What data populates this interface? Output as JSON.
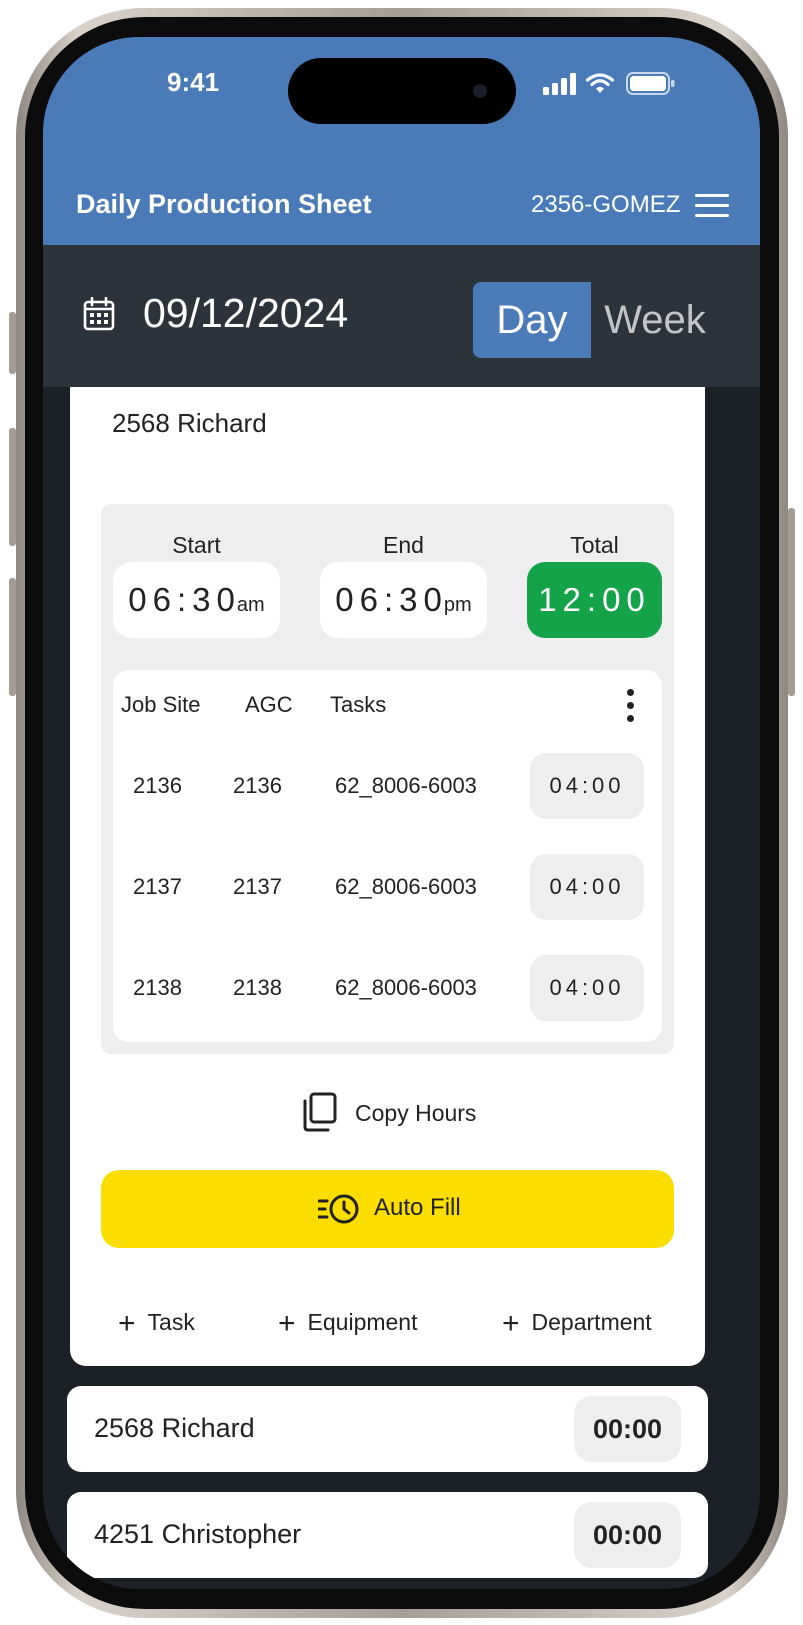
{
  "status_bar": {
    "time": "9:41",
    "icons": [
      "signal-icon",
      "wifi-icon",
      "battery-icon"
    ]
  },
  "header": {
    "title": "Daily Production Sheet",
    "user_code": "2356-GOMEZ",
    "menu_icon": "hamburger-menu-icon"
  },
  "date_bar": {
    "date": "09/12/2024",
    "calendar_icon": "calendar-icon",
    "view_toggle": {
      "day_label": "Day",
      "week_label": "Week",
      "selected": "Day"
    }
  },
  "employee_card": {
    "name": "2568 Richard",
    "times": {
      "start_label": "Start",
      "start_time": "06:30",
      "start_ampm": "am",
      "end_label": "End",
      "end_time": "06:30",
      "end_ampm": "pm",
      "total_label": "Total",
      "total": "12:00"
    },
    "table": {
      "headers": [
        "Job Site",
        "AGC",
        "Tasks"
      ],
      "rows": [
        {
          "job_site": "2136",
          "agc": "2136",
          "task": "62_8006-6003",
          "hours": "04:00"
        },
        {
          "job_site": "2137",
          "agc": "2137",
          "task": "62_8006-6003",
          "hours": "04:00"
        },
        {
          "job_site": "2138",
          "agc": "2138",
          "task": "62_8006-6003",
          "hours": "04:00"
        }
      ]
    },
    "copy_hours_label": "Copy Hours",
    "auto_fill_label": "Auto Fill",
    "add_links": {
      "task": "Task",
      "equipment": "Equipment",
      "department": "Department"
    }
  },
  "employees": [
    {
      "name": "2568 Richard",
      "hours": "00:00"
    },
    {
      "name": "4251 Christopher",
      "hours": "00:00"
    }
  ],
  "colors": {
    "header_blue": "#4a7ab8",
    "date_bar": "#2d333b",
    "background": "#1c2127",
    "total_green": "#15a34a",
    "auto_fill_yellow": "#fbde00"
  }
}
